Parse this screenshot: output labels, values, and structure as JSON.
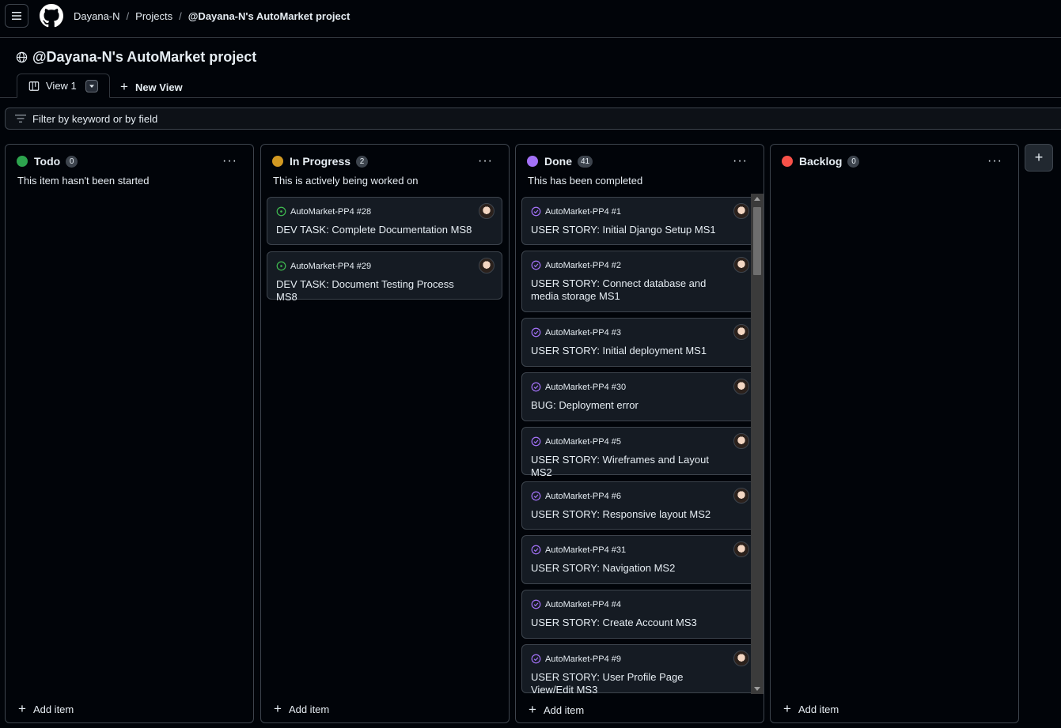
{
  "breadcrumb": {
    "owner": "Dayana-N",
    "projects": "Projects",
    "project": "@Dayana-N's AutoMarket project",
    "separator": "/"
  },
  "page": {
    "title": "@Dayana-N's AutoMarket project"
  },
  "tabs": {
    "active": "View 1",
    "new_view": "New View"
  },
  "filter": {
    "placeholder": "Filter by keyword or by field"
  },
  "columns": [
    {
      "name": "Todo",
      "count": "0",
      "description": "This item hasn't been started",
      "color": "#2da44e",
      "add_label": "Add item",
      "cards": []
    },
    {
      "name": "In Progress",
      "count": "2",
      "description": "This is actively being worked on",
      "color": "#d29922",
      "add_label": "Add item",
      "cards": [
        {
          "repo": "AutoMarket-PP4 #28",
          "title": "DEV TASK: Complete Documentation MS8",
          "status": "open"
        },
        {
          "repo": "AutoMarket-PP4 #29",
          "title": "DEV TASK: Document Testing Process MS8",
          "status": "open"
        }
      ]
    },
    {
      "name": "Done",
      "count": "41",
      "description": "This has been completed",
      "color": "#a371f7",
      "add_label": "Add item",
      "cards": [
        {
          "repo": "AutoMarket-PP4 #1",
          "title": "USER STORY: Initial Django Setup MS1",
          "status": "done"
        },
        {
          "repo": "AutoMarket-PP4 #2",
          "title": "USER STORY: Connect database and media storage MS1",
          "status": "done"
        },
        {
          "repo": "AutoMarket-PP4 #3",
          "title": "USER STORY: Initial deployment MS1",
          "status": "done"
        },
        {
          "repo": "AutoMarket-PP4 #30",
          "title": "BUG: Deployment error",
          "status": "done"
        },
        {
          "repo": "AutoMarket-PP4 #5",
          "title": "USER STORY: Wireframes and Layout MS2",
          "status": "done"
        },
        {
          "repo": "AutoMarket-PP4 #6",
          "title": "USER STORY: Responsive layout MS2",
          "status": "done"
        },
        {
          "repo": "AutoMarket-PP4 #31",
          "title": "USER STORY: Navigation MS2",
          "status": "done"
        },
        {
          "repo": "AutoMarket-PP4 #4",
          "title": "USER STORY: Create Account MS3",
          "status": "done"
        },
        {
          "repo": "AutoMarket-PP4 #9",
          "title": "USER STORY: User Profile Page View/Edit MS3",
          "status": "done"
        }
      ]
    },
    {
      "name": "Backlog",
      "count": "0",
      "description": "",
      "color": "#f85149",
      "add_label": "Add item",
      "cards": []
    }
  ],
  "icons": {
    "menu": "hamburger-icon",
    "logo": "github-logo-icon",
    "globe": "globe-icon",
    "board": "board-icon",
    "more": "kebab-horizontal-icon",
    "plus": "plus-icon",
    "filter": "filter-icon",
    "open_issue": "issue-opened-icon",
    "closed_issue": "issue-closed-icon"
  }
}
